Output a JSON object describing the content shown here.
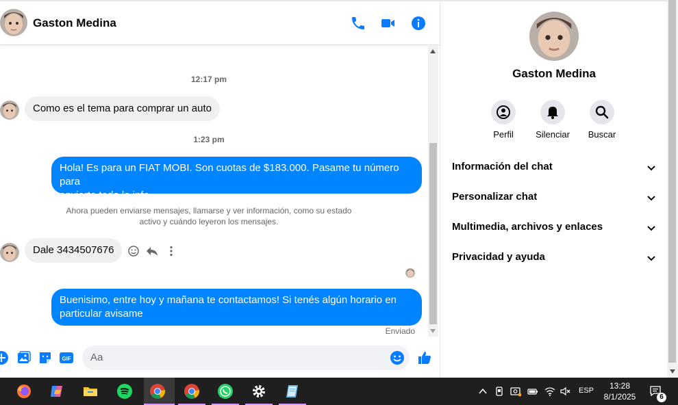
{
  "chat": {
    "contact_name": "Gaston Medina",
    "messages": {
      "ts1": "12:17 pm",
      "in1": "Como es el tema para comprar un auto",
      "ts2": "1:23 pm",
      "out1_line1": "Hola! Es para un FIAT MOBI. Son cuotas de $183.000. Pasame tu número para",
      "out1_line2": "enviarte toda la info",
      "system_line1": "Ahora pueden enviarse mensajes, llamarse y ver información, como su estado",
      "system_line2": "activo y cuándo leyeron los mensajes.",
      "in2": "Dale 3434507676",
      "out2_line1": "Buenisimo, entre hoy y mañana te contactamos! Si tenés algún horario en",
      "out2_line2": "particular avisame",
      "status": "Enviado"
    },
    "composer": {
      "placeholder": "Aa"
    },
    "accent_color": "#0084ff"
  },
  "info_panel": {
    "name": "Gaston Medina",
    "actions": [
      {
        "label": "Perfil",
        "icon": "profile-icon"
      },
      {
        "label": "Silenciar",
        "icon": "bell-icon"
      },
      {
        "label": "Buscar",
        "icon": "search-icon"
      }
    ],
    "sections": [
      {
        "label": "Información del chat"
      },
      {
        "label": "Personalizar chat"
      },
      {
        "label": "Multimedia, archivos y enlaces"
      },
      {
        "label": "Privacidad y ayuda"
      }
    ]
  },
  "taskbar": {
    "apps": [
      "firefox-icon",
      "copilot-icon",
      "file-explorer-icon",
      "spotify-icon",
      "chrome-icon",
      "chrome-icon",
      "whatsapp-icon",
      "settings-icon",
      "notepad-icon"
    ],
    "language": "ESP",
    "time": "13:28",
    "date": "8/1/2025",
    "notification_count": "6"
  }
}
